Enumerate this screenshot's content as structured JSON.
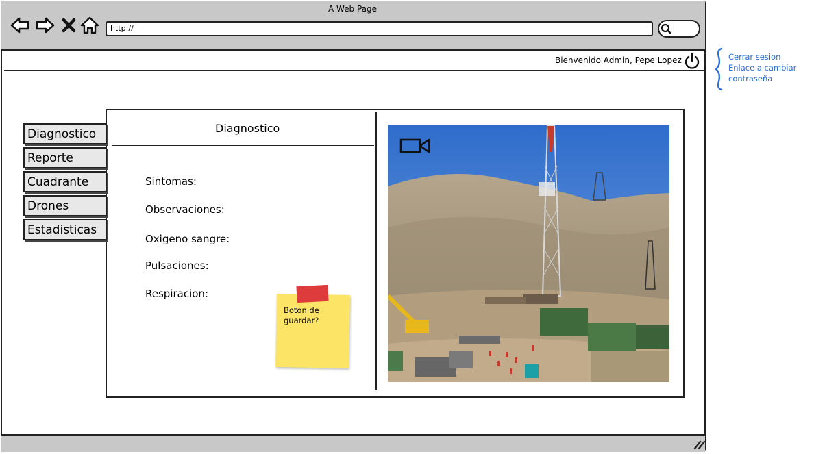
{
  "browser": {
    "window_title": "A Web Page",
    "url": "http://"
  },
  "header": {
    "welcome_text": "Bienvenido Admin, Pepe Lopez"
  },
  "annotation": {
    "lines": [
      "Cerrar sesion",
      "Enlace a cambiar",
      "contraseña"
    ],
    "color": "#2b6fd6"
  },
  "sidebar": {
    "items": [
      {
        "label": "Diagnostico"
      },
      {
        "label": "Reporte"
      },
      {
        "label": "Cuadrante"
      },
      {
        "label": "Drones"
      },
      {
        "label": "Estadisticas"
      }
    ]
  },
  "main": {
    "title": "Diagnostico",
    "fields": [
      {
        "label": "Sintomas:"
      },
      {
        "label": "Observaciones:"
      },
      {
        "label": "Oxigeno sangre:"
      },
      {
        "label": "Pulsaciones:"
      },
      {
        "label": "Respiracion:"
      }
    ],
    "sticky_note": "Boton de guardar?",
    "icons": {
      "camera": "video-camera-icon",
      "power": "power-icon"
    }
  },
  "colors": {
    "chrome_gray": "#c8c8c8",
    "sticky_yellow": "#fce566",
    "tape_red": "#de3c3c",
    "sky": "#3a77d0"
  }
}
